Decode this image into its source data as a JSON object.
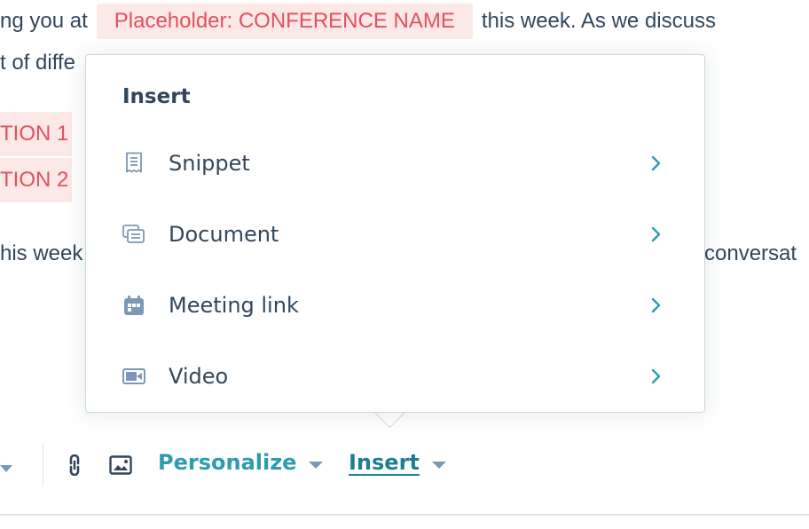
{
  "editor": {
    "line1_before": "ng you at",
    "line1_placeholder": "Placeholder: CONFERENCE NAME",
    "line1_after": "this week. As we discuss",
    "line2_before": "t of diffe",
    "line3_placeholder": "TION 1",
    "line4_placeholder": "TION 2",
    "line5_before": "his week",
    "line5_after": "conversat"
  },
  "popover": {
    "title": "Insert",
    "items": [
      {
        "label": "Snippet",
        "icon": "snippet-icon"
      },
      {
        "label": "Document",
        "icon": "document-icon"
      },
      {
        "label": "Meeting link",
        "icon": "meeting-calendar-icon"
      },
      {
        "label": "Video",
        "icon": "video-icon"
      }
    ]
  },
  "toolbar": {
    "personalize_label": "Personalize",
    "insert_label": "Insert",
    "icons": [
      "caret-down-icon",
      "link-icon",
      "image-icon"
    ]
  },
  "colors": {
    "text": "#33475b",
    "placeholder_bg": "#fde8e8",
    "placeholder_text": "#e0525b",
    "accent": "#2e9bb0",
    "icon": "#7c98b6",
    "border": "#cbd6e2"
  }
}
